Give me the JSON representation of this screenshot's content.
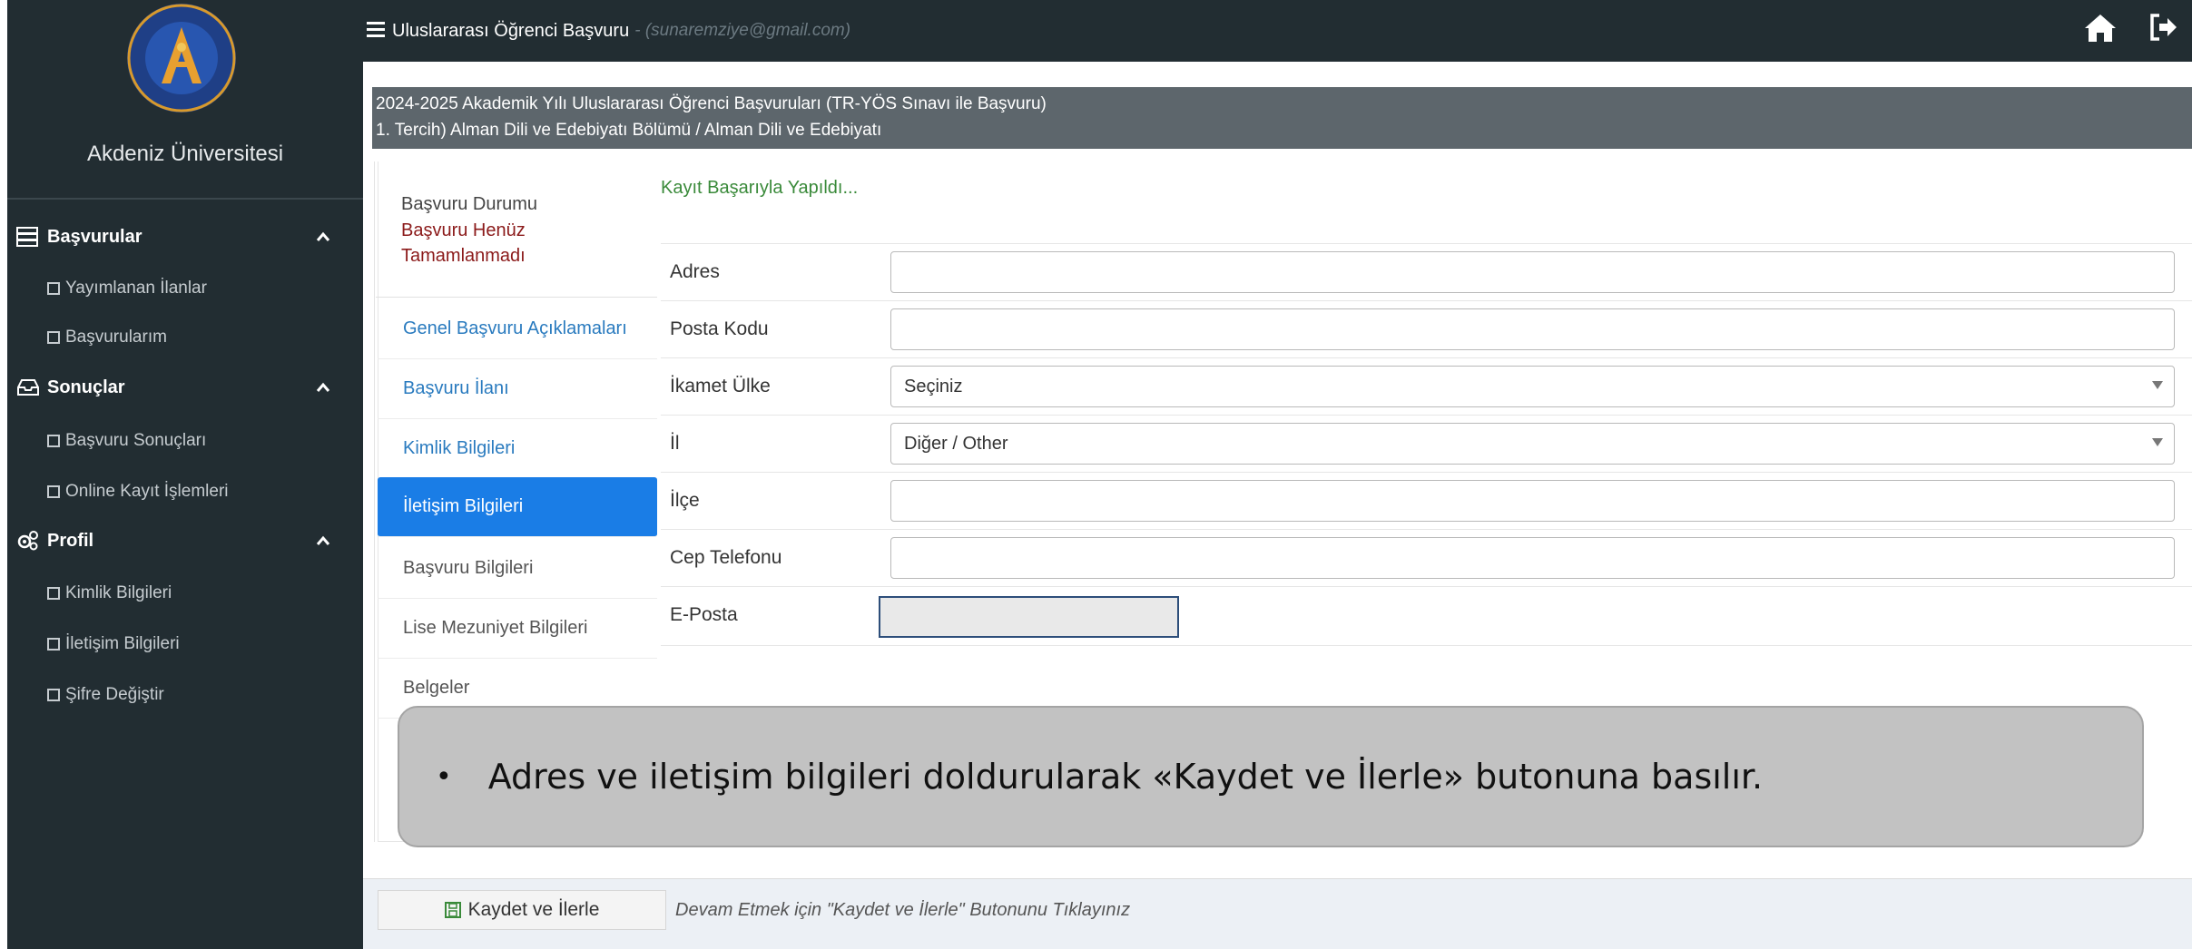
{
  "sidebar": {
    "university_name": "Akdeniz Üniversitesi",
    "sections": [
      {
        "label": "Başvurular",
        "icon": "server-icon",
        "items": [
          "Yayımlanan İlanlar",
          "Başvurularım"
        ]
      },
      {
        "label": "Sonuçlar",
        "icon": "inbox-icon",
        "items": [
          "Başvuru Sonuçları",
          "Online Kayıt İşlemleri"
        ]
      },
      {
        "label": "Profil",
        "icon": "cogs-icon",
        "items": [
          "Kimlik Bilgileri",
          "İletişim Bilgileri",
          "Şifre Değiştir"
        ]
      }
    ]
  },
  "topbar": {
    "title": "Uluslararası Öğrenci Başvuru",
    "email": "- (sunaremziye@gmail.com)"
  },
  "header": {
    "line1": "2024-2025 Akademik Yılı Uluslararası Öğrenci Başvuruları (TR-YÖS Sınavı ile Başvuru)",
    "line2": "1. Tercih) Alman Dili ve Edebiyatı Bölümü / Alman Dili ve Edebiyatı"
  },
  "status": {
    "label": "Başvuru Durumu",
    "value": "Başvuru Henüz Tamamlanmadı"
  },
  "menu": [
    "Genel Başvuru Açıklamaları",
    "Başvuru İlanı",
    "Kimlik Bilgileri",
    "İletişim Bilgileri",
    "Başvuru Bilgileri",
    "Lise Mezuniyet Bilgileri",
    "Belgeler"
  ],
  "form": {
    "success_message": "Kayıt Başarıyla Yapıldı...",
    "fields": [
      {
        "label": "Adres",
        "value": ""
      },
      {
        "label": "Posta Kodu",
        "value": ""
      },
      {
        "label": "İkamet Ülke",
        "value": "Seçiniz"
      },
      {
        "label": "İl",
        "value": "Diğer / Other"
      },
      {
        "label": "İlçe",
        "value": ""
      },
      {
        "label": "Cep Telefonu",
        "value": ""
      },
      {
        "label": "E-Posta",
        "value": ""
      }
    ]
  },
  "callout": {
    "text": "Adres ve iletişim bilgileri doldurularak «Kaydet ve İlerle» butonuna basılır."
  },
  "footer": {
    "save_label": "Kaydet ve İlerle",
    "hint": "Devam Etmek için \"Kaydet ve İlerle\" Butonunu Tıklayınız"
  },
  "colors": {
    "sidebar_bg": "#222d32",
    "active_menu": "#1a7de6",
    "link": "#2a7bbf",
    "status_red": "#8b1a1a",
    "success_green": "#3a8a3a"
  }
}
